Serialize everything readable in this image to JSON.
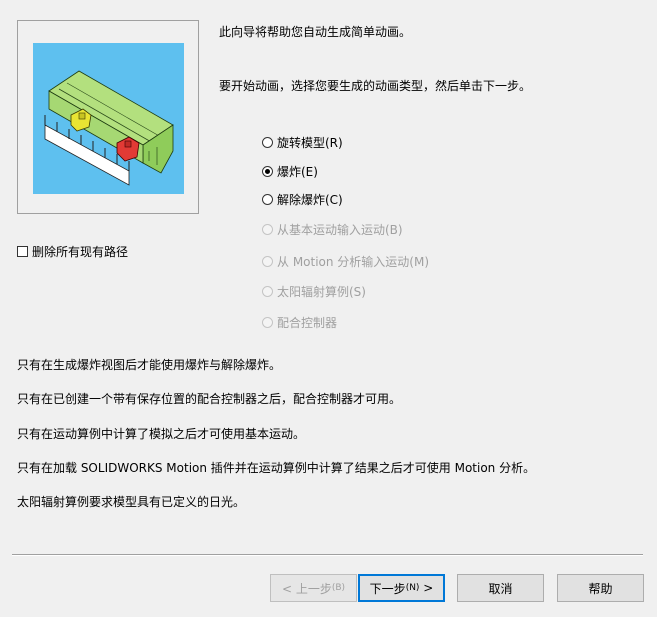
{
  "intro": {
    "line1": "此向导将帮助您自动生成简单动画。",
    "line2": "要开始动画，选择您要生成的动画类型，然后单击下一步。"
  },
  "animation_types": [
    {
      "label": "旋转模型(R)",
      "checked": false,
      "enabled": true
    },
    {
      "label": "爆炸(E)",
      "checked": true,
      "enabled": true
    },
    {
      "label": "解除爆炸(C)",
      "checked": false,
      "enabled": true
    },
    {
      "label": "从基本运动输入运动(B)",
      "checked": false,
      "enabled": false
    },
    {
      "label": "从 Motion 分析输入运动(M)",
      "checked": false,
      "enabled": false
    },
    {
      "label": "太阳辐射算例(S)",
      "checked": false,
      "enabled": false
    },
    {
      "label": "配合控制器",
      "checked": false,
      "enabled": false
    }
  ],
  "delete_paths": {
    "label": "删除所有现有路径",
    "checked": false
  },
  "notes": [
    "只有在生成爆炸视图后才能使用爆炸与解除爆炸。",
    "只有在已创建一个带有保存位置的配合控制器之后，配合控制器才可用。",
    "只有在运动算例中计算了模拟之后才可使用基本运动。",
    "只有在加载 SOLIDWORKS Motion 插件并在运动算例中计算了结果之后才可使用 Motion 分析。",
    "太阳辐射算例要求模型具有已定义的日光。"
  ],
  "buttons": {
    "back": {
      "label": "< 上一步",
      "accel": "(B)",
      "enabled": false
    },
    "next": {
      "label": "下一步",
      "accel": "(N)",
      "suffix": " >",
      "enabled": true
    },
    "cancel": {
      "label": "取消",
      "enabled": true
    },
    "help": {
      "label": "帮助",
      "enabled": true
    }
  },
  "colors": {
    "preview_background": "#5ec0ef",
    "model_green": "#9ed36a",
    "highlight_yellow": "#e9e433",
    "highlight_red": "#e23a35",
    "default_button_border": "#0078d7"
  }
}
